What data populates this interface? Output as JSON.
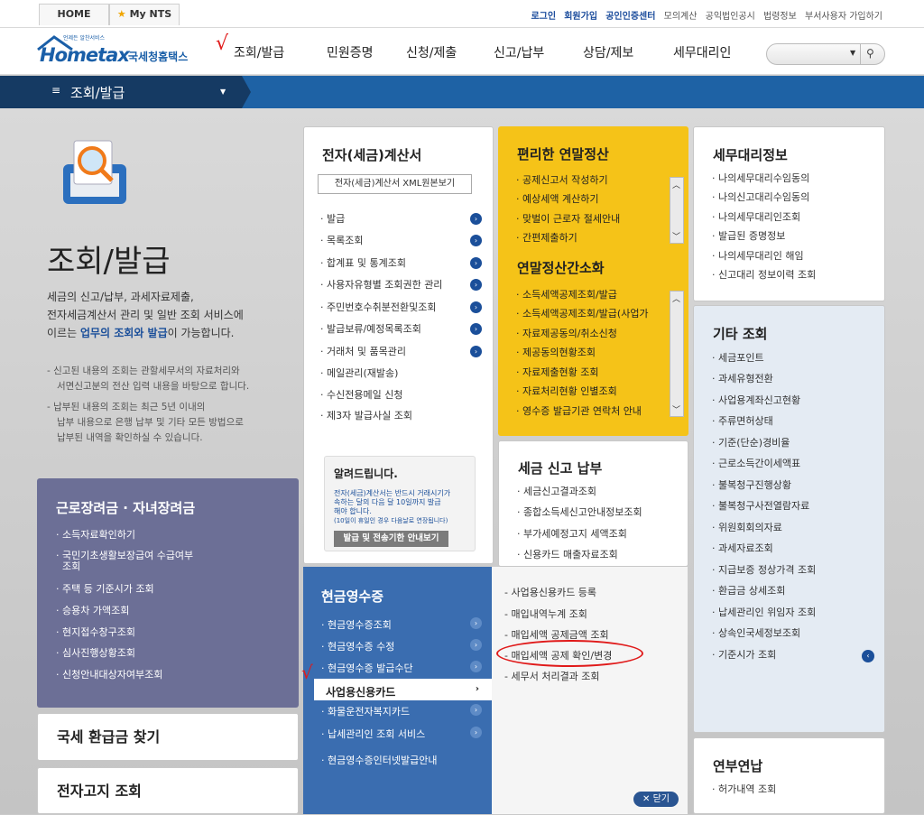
{
  "util": {
    "tabs": [
      "HOME",
      "My NTS"
    ],
    "links": [
      "로그인",
      "회원가입",
      "공인인증센터",
      "모의계산",
      "공익법인공시",
      "법령정보",
      "부서사용자 가입하기"
    ]
  },
  "brand": {
    "logo_small": "언제든 알찬서비스",
    "logo_main": "Hometax",
    "logo_sub": "국세청홈택스"
  },
  "gnb": {
    "items": [
      "조회/발급",
      "민원증명",
      "신청/제출",
      "신고/납부",
      "상담/제보",
      "세무대리인"
    ],
    "search_placeholder": ""
  },
  "subbar": {
    "menu_icon": "≡",
    "title": "조회/발급"
  },
  "left": {
    "title": "조회/발급",
    "desc": [
      "세금의 신고/납부, 과세자료제출,",
      "전자세금계산서 관리 및 일반 조회 서비스에",
      "이르는 ",
      "업무의 조회와 발급",
      "이 가능합니다."
    ],
    "note1": [
      "- 신고된 내용의 조회는 관할세무서의 자료처리와",
      "서면신고분의 전산 입력 내용을 바탕으로 합니다."
    ],
    "note2": [
      "- 납부된 내용의 조회는 최근 5년 이내의",
      "납부 내용으로 은행 납부 및 기타 모든 방법으로",
      "납부된 내역을 확인하실 수 있습니다."
    ]
  },
  "purple": {
    "title": "근로장려금 · 자녀장려금",
    "items": [
      "소득자료확인하기",
      "국민기초생활보장급여 수급여부",
      "조회",
      "주택 등 기준시가 조회",
      "승용차 가액조회",
      "현지접수창구조회",
      "심사진행상황조회",
      "신청안내대상자여부조회"
    ]
  },
  "refund_btn": "국세 환급금 찾기",
  "notice_btn": "전자고지 조회",
  "einvoice": {
    "title": "전자(세금)계산서",
    "xml_btn": "전자(세금)계산서 XML원본보기",
    "items": [
      "발급",
      "목록조회",
      "합계표 및 통계조회",
      "사용자유형별 조회권한 관리",
      "주민번호수취분전환및조회",
      "발급보류/예정목록조회",
      "거래처 및 품목관리",
      "메일관리(재발송)",
      "수신전용메일 신청",
      "제3자 발급사실 조회"
    ],
    "notice_title": "알려드립니다.",
    "notice_text": [
      "전자(세금)계산서는 반드시 거래시기가",
      "속하는 달의 다음 달 10일까지 발급",
      "해야 합니다.",
      "(10일이 휴일인 경우 다음날로 연장됩니다)"
    ],
    "notice_btn": "발급 및 전송기한 안내보기"
  },
  "yearend": {
    "title": "편리한 연말정산",
    "items": [
      "공제신고서 작성하기",
      "예상세액 계산하기",
      "맞벌이 근로자 절세안내",
      "간편제출하기"
    ],
    "title2": "연말정산간소화",
    "items2": [
      "소득세액공제조회/발급",
      "소득세액공제조회/발급(사업가",
      "자료제공동의/취소신청",
      "제공동의현황조회",
      "자료제출현황 조회",
      "자료처리현황 인별조회",
      "영수증 발급기관 연락처 안내"
    ]
  },
  "taxfile": {
    "title": "세금 신고 납부",
    "items": [
      "세금신고결과조회",
      "종합소득세신고안내정보조회",
      "부가세예정고지 세액조회",
      "신용카드 매출자료조회"
    ]
  },
  "cash": {
    "title": "현금영수증",
    "items": [
      "현금영수증조회",
      "현금영수증 수정",
      "현금영수증 발급수단",
      "사업용신용카드",
      "화물운전자복지카드",
      "납세관리인 조회 서비스",
      "현금영수증인터넷발급안내"
    ],
    "sub_items": [
      "사업용신용카드 등록",
      "매입내역누계 조회",
      "매입세액 공제금액 조회",
      "매입세액 공제 확인/변경",
      "세무서 처리결과 조회"
    ],
    "close": "닫기"
  },
  "agent": {
    "title": "세무대리정보",
    "items": [
      "나의세무대리수임동의",
      "나의신고대리수임동의",
      "나의세무대리인조회",
      "발급된 증명정보",
      "나의세무대리인 해임",
      "신고대리 정보이력 조회"
    ]
  },
  "etc": {
    "title": "기타 조회",
    "items": [
      "세금포인트",
      "과세유형전환",
      "사업용계좌신고현황",
      "주류면허상태",
      "기준(단순)경비율",
      "근로소득간이세액표",
      "불복청구진행상황",
      "불복청구사전열람자료",
      "위원회회의자료",
      "과세자료조회",
      "지급보증 정상가격 조회",
      "환급금 상세조회",
      "납세관리인 위임자 조회",
      "상속인국세정보조회",
      "기준시가 조회"
    ]
  },
  "donation": {
    "title": "연부연납",
    "items": [
      "허가내역 조회"
    ]
  },
  "annotations": {
    "checkmark_1": "√",
    "checkmark_2": "√"
  }
}
